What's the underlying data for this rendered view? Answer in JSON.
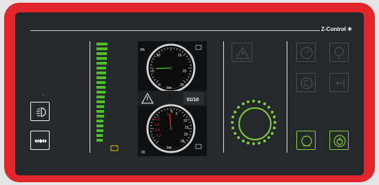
{
  "brand": {
    "name": "Z-Control",
    "mark": "✳"
  },
  "buttons": {
    "work_light": {
      "icon": "work-light-icon",
      "indicator": "°"
    },
    "beacon": {
      "icon": "beacon-arrows-icon"
    },
    "warning": {
      "icon": "warning-triangle-icon",
      "state": "inactive"
    },
    "gauge_upper": {
      "icon": "gauge-dial-icon",
      "state": "inactive"
    },
    "pressure_icon": {
      "icon": "pressure-valve-icon",
      "state": "inactive"
    },
    "c_symbol": {
      "icon": "c-circle-icon",
      "state": "inactive"
    },
    "arrow_in": {
      "icon": "arrow-in-icon",
      "state": "inactive"
    },
    "pump_on": {
      "icon": "pump-icon",
      "state": "active"
    },
    "power_on": {
      "icon": "power-icon",
      "state": "active"
    }
  },
  "level_bar": {
    "total_segments": 21,
    "lit_segments": 21,
    "battery_icon": "battery-icon",
    "color": "#4fbf2a"
  },
  "display": {
    "top_gauge": {
      "ticks": [
        "0",
        "5",
        "10",
        "15",
        "20",
        "25"
      ],
      "unit": "bar",
      "corner_left": "3%",
      "needle_value": 4,
      "needle_color": "#4fbf2a"
    },
    "bottom_gauge": {
      "ticks": [
        "0",
        "5",
        "10",
        "15",
        "20",
        "25"
      ],
      "negative_ticks": [
        "-1",
        "-0.8",
        "-0.6",
        "-0.4",
        "-0.2"
      ],
      "unit": "bar",
      "corner_left": "00",
      "needle_value": 12,
      "needle_color": "#e2252b"
    },
    "counter": "01/10",
    "warning_icon": "warning-triangle-icon"
  },
  "dial": {
    "color": "#7fd13b",
    "dots": 24
  },
  "accent": "#e2252b"
}
